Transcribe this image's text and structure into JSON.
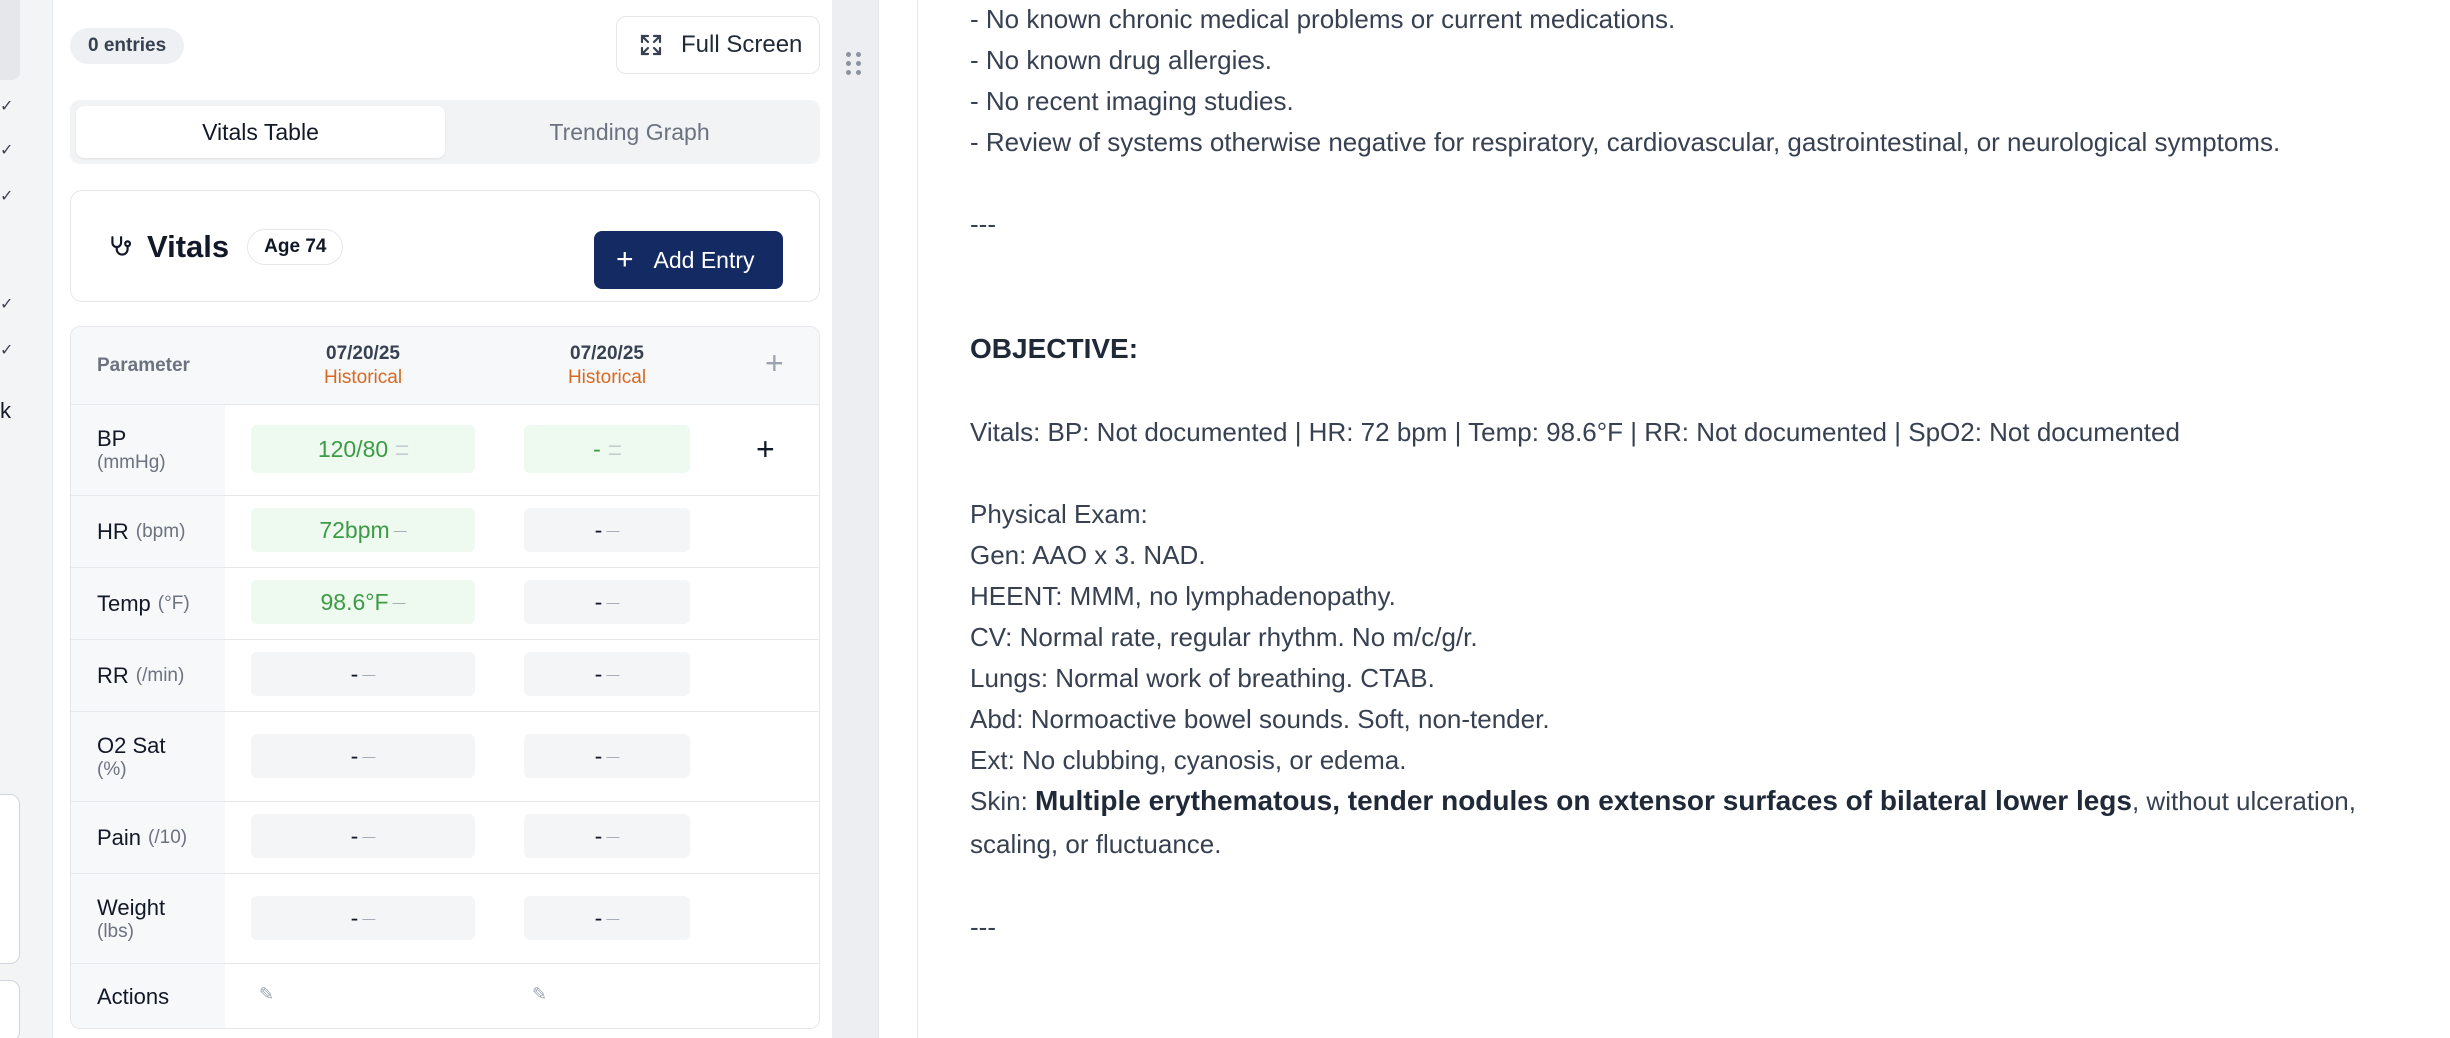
{
  "left_panel": {
    "checks": [
      "✓",
      "✓",
      "✓",
      "✓",
      "✓"
    ],
    "k_text": "k"
  },
  "vitals": {
    "entries_count": "0 entries",
    "fullscreen_label": "Full Screen",
    "tabs": [
      {
        "label": "Vitals Table",
        "active": true
      },
      {
        "label": "Trending Graph",
        "active": false
      }
    ],
    "title": "Vitals",
    "age_badge": "Age 74",
    "add_entry_label": "Add Entry",
    "table": {
      "param_header": "Parameter",
      "columns": [
        {
          "date": "07/20/25",
          "status": "Historical"
        },
        {
          "date": "07/20/25",
          "status": "Historical"
        }
      ],
      "rows": [
        {
          "name": "BP",
          "unit": "(mmHg)",
          "values": [
            "120/80",
            "-"
          ]
        },
        {
          "name": "HR",
          "unit": "(bpm)",
          "values": [
            "72bpm",
            "-"
          ]
        },
        {
          "name": "Temp",
          "unit": "(°F)",
          "values": [
            "98.6°F",
            "-"
          ]
        },
        {
          "name": "RR",
          "unit": "(/min)",
          "values": [
            "-",
            "-"
          ]
        },
        {
          "name": "O2 Sat",
          "unit": "(%)",
          "values": [
            "-",
            "-"
          ]
        },
        {
          "name": "Pain",
          "unit": "(/10)",
          "values": [
            "-",
            "-"
          ]
        },
        {
          "name": "Weight",
          "unit": "(lbs)",
          "values": [
            "-",
            "-"
          ]
        }
      ],
      "actions_label": "Actions"
    }
  },
  "document": {
    "lines": [
      "- No known chronic medical problems or current medications.",
      "- No known drug allergies.",
      "- No recent imaging studies.",
      "- Review of systems otherwise negative for respiratory, cardiovascular, gastrointestinal, or neurological symptoms."
    ],
    "separator1": "---",
    "objective_heading": "OBJECTIVE:",
    "vitals_line": "Vitals: BP: Not documented | HR: 72 bpm | Temp: 98.6°F | RR: Not documented | SpO2: Not documented",
    "exam_heading": "Physical Exam:",
    "exam_lines": [
      "Gen: AAO x 3. NAD.",
      "HEENT: MMM, no lymphadenopathy.",
      "CV: Normal rate, regular rhythm. No m/c/g/r.",
      "Lungs: Normal work of breathing. CTAB.",
      "Abd: Normoactive bowel sounds. Soft, non-tender.",
      "Ext: No clubbing, cyanosis, or edema."
    ],
    "skin_prefix": "Skin: ",
    "skin_bold": "Multiple erythematous, tender nodules on extensor surfaces of bilateral lower legs",
    "skin_suffix": ", without ulceration,",
    "skin_continuation": "scaling, or fluctuance.",
    "separator2": "---"
  }
}
